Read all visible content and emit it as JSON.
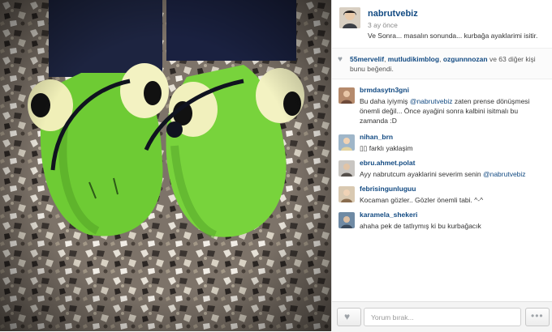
{
  "post": {
    "username": "nabrutvebiz",
    "time": "3 ay önce",
    "caption": "Ve Sonra... masalın sonunda... kurbağa ayaklarimi isitir."
  },
  "likes": {
    "users": [
      "55mervelif",
      "mutludikimblog",
      "ozgunnnozan"
    ],
    "sep1": ", ",
    "sep2": ", ",
    "connector": " ve ",
    "count": "63",
    "suffix": " diğer kişi bunu beğendi."
  },
  "comments": [
    {
      "user": "brmdasytn3gni",
      "text": "Bu daha iyiymiş ",
      "mention": "@nabrutvebiz",
      "text2": " zaten prense dönüşmesi önemli değil... Önce ayağini sonra kalbini isitmalı bu zamanda :D"
    },
    {
      "user": "nihan_brn",
      "text": "▯▯ farklı yaklaşim"
    },
    {
      "user": "ebru.ahmet.polat",
      "text": "Ayy nabrutcum ayaklarini severim senin ",
      "mention": "@nabrutvebiz"
    },
    {
      "user": "febrisingunluguu",
      "text": "Kocaman gözler.. Gözler önemli tabi. ^-^"
    },
    {
      "user": "karamela_shekeri",
      "text": "ahaha pek de tatlıymış ki bu kurbağacık"
    }
  ],
  "footer": {
    "placeholder": "Yorum bırak..."
  },
  "icons": {
    "heart": "heart-icon",
    "more": "more-options-icon"
  },
  "colors": {
    "link": "#124a82",
    "slipper_green": "#6ecb34"
  }
}
